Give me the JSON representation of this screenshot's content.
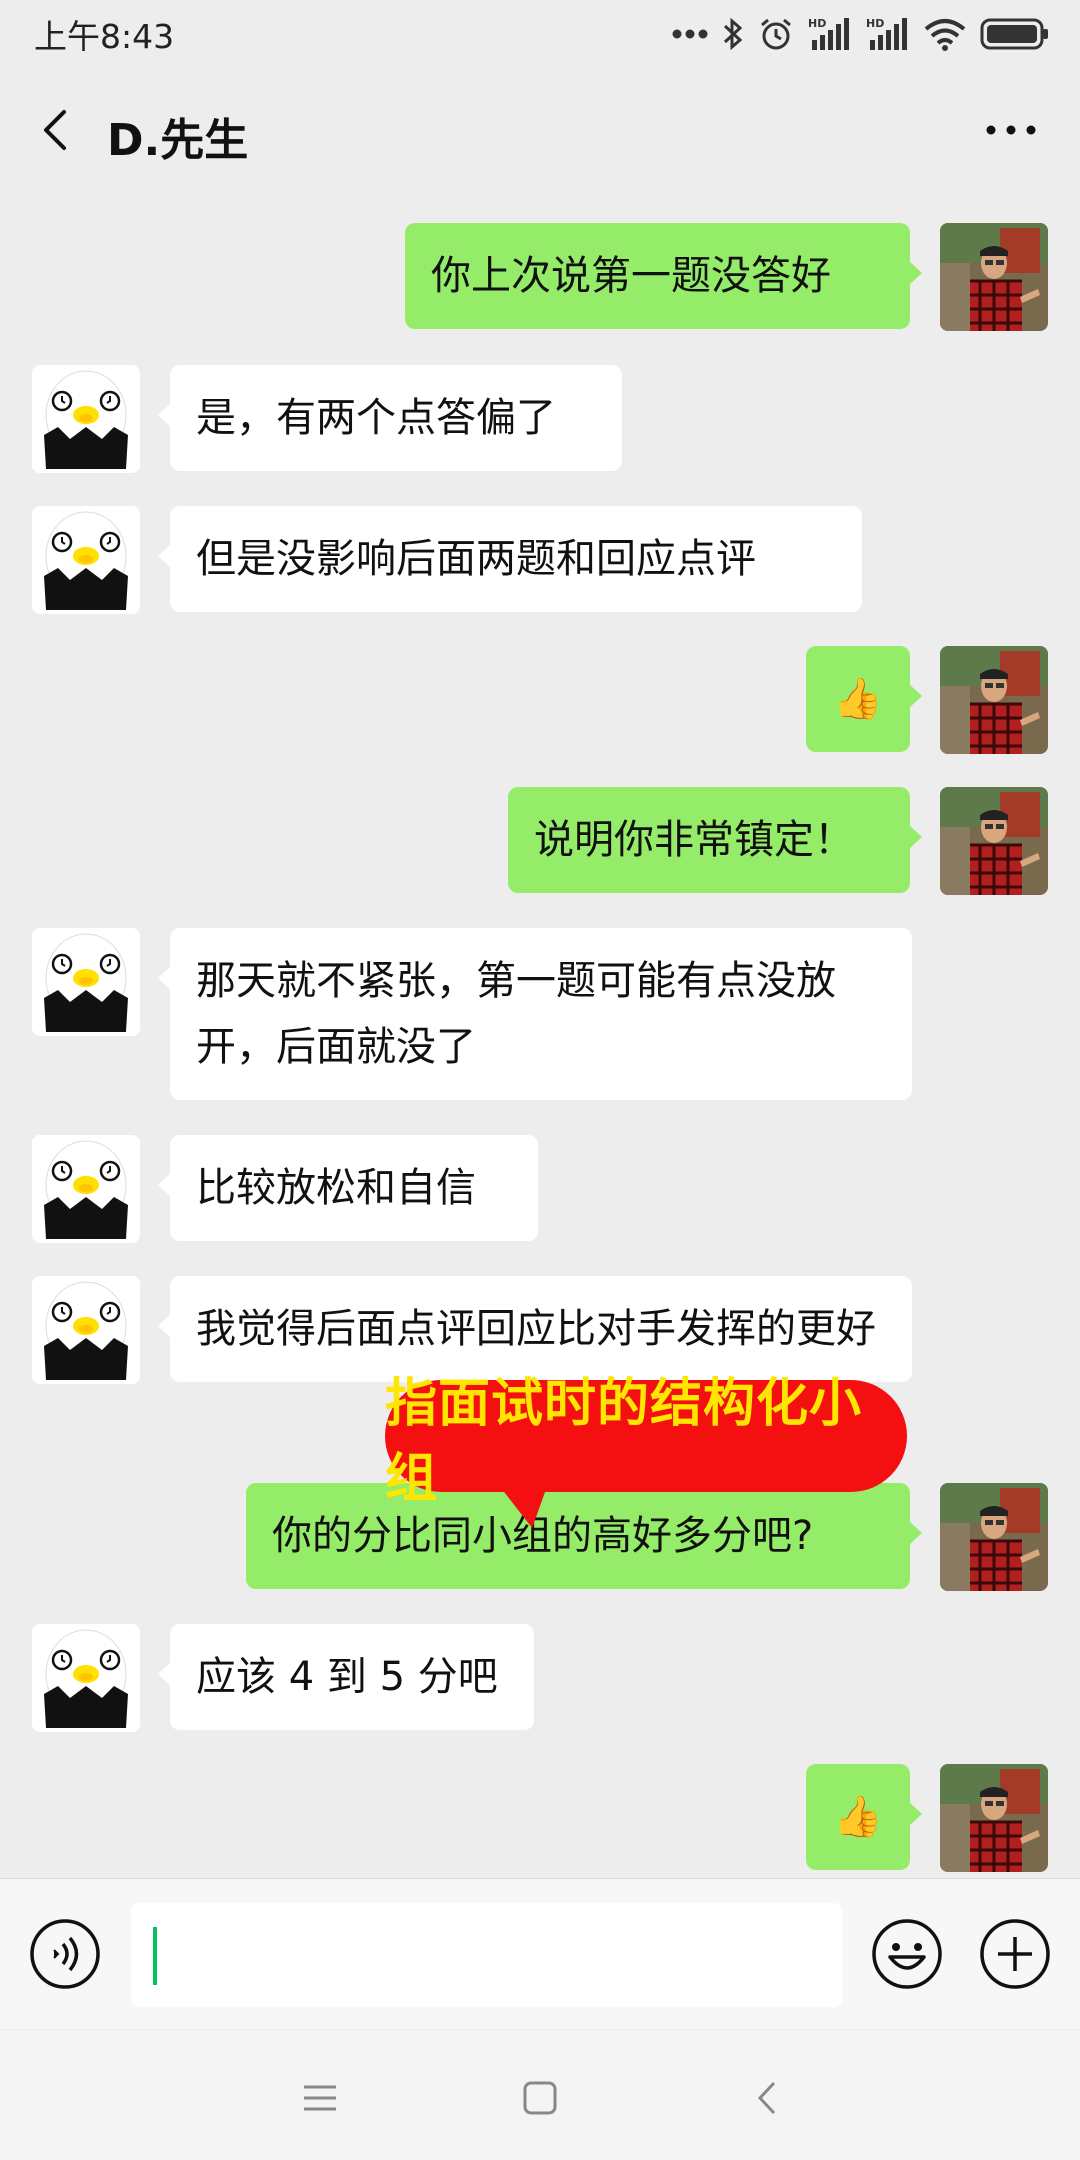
{
  "status_bar": {
    "time": "上午8:43",
    "icons": [
      "more-dots-icon",
      "bluetooth-icon",
      "alarm-icon",
      "hd-signal-icon",
      "hd-signal-icon",
      "wifi-icon",
      "battery-icon"
    ]
  },
  "header": {
    "title": "D.先生",
    "back_icon": "chevron-left-icon",
    "more_icon": "more-icon"
  },
  "colors": {
    "background": "#ededed",
    "sent_bubble": "#95ec69",
    "received_bubble": "#ffffff",
    "annotation_bg": "#f41010",
    "annotation_text": "#ffe600",
    "caret": "#07c160"
  },
  "messages": [
    {
      "from": "me",
      "text": "你上次说第一题没答好"
    },
    {
      "from": "them",
      "text": "是，有两个点答偏了"
    },
    {
      "from": "them",
      "text": "但是没影响后面两题和回应点评"
    },
    {
      "from": "me",
      "text": "👍"
    },
    {
      "from": "me",
      "text": "说明你非常镇定！"
    },
    {
      "from": "them",
      "text": "那天就不紧张，第一题可能有点没放开，后面就没了"
    },
    {
      "from": "them",
      "text": "比较放松和自信"
    },
    {
      "from": "them",
      "text": "我觉得后面点评回应比对手发挥的更好"
    },
    {
      "from": "me",
      "text": "你的分比同小组的高好多分吧?"
    },
    {
      "from": "them",
      "text": "应该 4 到 5 分吧"
    },
    {
      "from": "me",
      "text": "👍"
    }
  ],
  "annotation": {
    "text": "指面试时的结构化小组"
  },
  "input_bar": {
    "voice_icon": "voice-icon",
    "input_value": "",
    "emoji_icon": "emoji-icon",
    "plus_icon": "plus-circle-icon"
  },
  "nav_bar": {
    "icons": [
      "menu-icon",
      "home-square-icon",
      "back-icon"
    ]
  }
}
